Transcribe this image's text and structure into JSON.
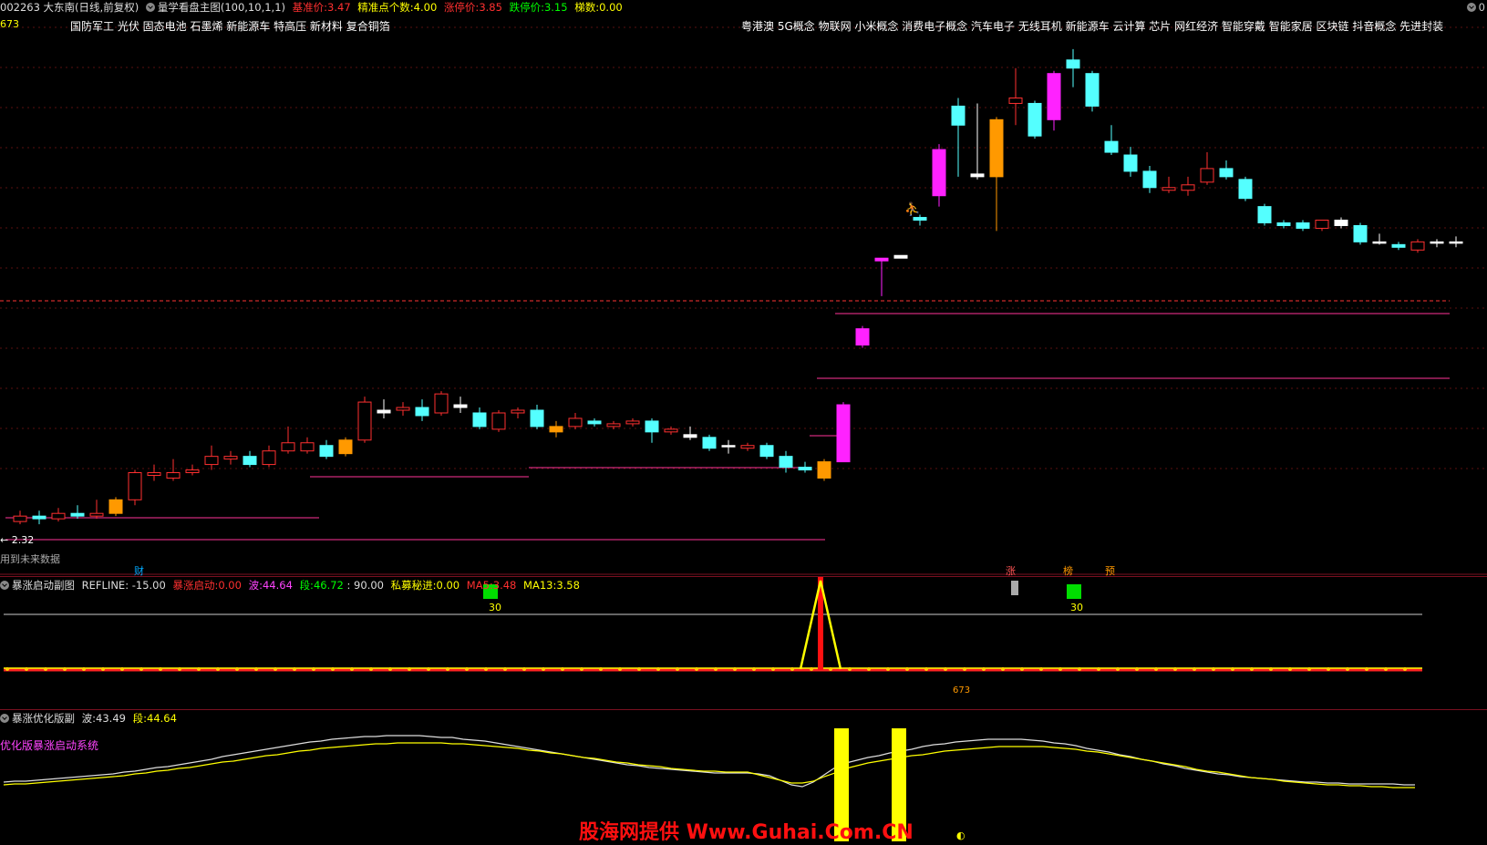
{
  "header": {
    "code_name": "002263 大东南(日线,前复权)",
    "indicator_name": "量学看盘主图(100,10,1,1)",
    "base_price_label": "基准价:",
    "base_price": "3.47",
    "precise_points_label": "精准点个数:",
    "precise_points": "4.00",
    "limit_up_label": "涨停价:",
    "limit_up": "3.85",
    "limit_down_label": "跌停价:",
    "limit_down": "3.15",
    "ladder_label": "梯数:",
    "ladder": "0.00",
    "right_top": "0"
  },
  "left_axis_value": "673",
  "concepts_left": "国防军工 光伏 固态电池 石墨烯 新能源车 特高压 新材料 复合铜箔",
  "concepts_right": "粤港澳 5G概念 物联网 小米概念 消费电子概念 汽车电子 无线耳机 新能源车 云计算 芯片 网红经济 智能穿戴 智能家居 区块链 抖音概念 先进封装",
  "price_low_label": "← 2.32",
  "future_data_label": "用到未来数据",
  "markers": {
    "cai": "财",
    "zhang": "涨",
    "bang": "榜",
    "yu": "预"
  },
  "sub1": {
    "name": "暴涨启动副图",
    "refline": "REFLINE: -15.00",
    "qidong_label": "暴涨启动:",
    "qidong": "0.00",
    "bo_label": "波:",
    "bo": "44.64",
    "duan_label": "段:",
    "duan": "46.72",
    "ninety": ": 90.00",
    "simu_label": "私募秘进:",
    "simu": "0.00",
    "ma5_label": "MA5:",
    "ma5": "3.48",
    "ma13_label": "MA13:",
    "ma13": "3.58",
    "mark30a": "30",
    "mark30b": "30",
    "mark673": "673"
  },
  "sub2": {
    "name": "暴涨优化版副",
    "bo_label": "波:",
    "bo": "43.49",
    "duan_label": "段:",
    "duan": "44.64",
    "system_label": "优化版暴涨启动系统"
  },
  "watermark": "股海网提供 Www.Guhai.Com.CN",
  "colors": {
    "up": "#ff3030",
    "down": "#54ffff",
    "magenta": "#ff22ff",
    "orange": "#ff9900",
    "yellow": "#ffff00",
    "green": "#00dd00",
    "grid": "#5a1010"
  },
  "icons": [
    "indicator-toggle-icon",
    "person-icon",
    "info-circle-icon"
  ],
  "candles": [
    {
      "o": 2.34,
      "c": 2.36,
      "h": 2.38,
      "l": 2.33,
      "t": "u"
    },
    {
      "o": 2.36,
      "c": 2.35,
      "h": 2.38,
      "l": 2.33,
      "t": "d"
    },
    {
      "o": 2.35,
      "c": 2.37,
      "h": 2.39,
      "l": 2.34,
      "t": "u"
    },
    {
      "o": 2.37,
      "c": 2.36,
      "h": 2.4,
      "l": 2.35,
      "t": "d"
    },
    {
      "o": 2.36,
      "c": 2.37,
      "h": 2.42,
      "l": 2.35,
      "t": "u"
    },
    {
      "o": 2.42,
      "c": 2.37,
      "h": 2.43,
      "l": 2.36,
      "t": "o"
    },
    {
      "o": 2.42,
      "c": 2.52,
      "h": 2.53,
      "l": 2.4,
      "t": "u"
    },
    {
      "o": 2.51,
      "c": 2.52,
      "h": 2.55,
      "l": 2.49,
      "t": "u"
    },
    {
      "o": 2.5,
      "c": 2.52,
      "h": 2.57,
      "l": 2.49,
      "t": "u"
    },
    {
      "o": 2.52,
      "c": 2.53,
      "h": 2.55,
      "l": 2.51,
      "t": "u"
    },
    {
      "o": 2.55,
      "c": 2.58,
      "h": 2.62,
      "l": 2.53,
      "t": "u"
    },
    {
      "o": 2.57,
      "c": 2.58,
      "h": 2.6,
      "l": 2.55,
      "t": "u"
    },
    {
      "o": 2.58,
      "c": 2.55,
      "h": 2.6,
      "l": 2.54,
      "t": "d"
    },
    {
      "o": 2.55,
      "c": 2.6,
      "h": 2.62,
      "l": 2.54,
      "t": "u"
    },
    {
      "o": 2.6,
      "c": 2.63,
      "h": 2.69,
      "l": 2.59,
      "t": "u"
    },
    {
      "o": 2.63,
      "c": 2.6,
      "h": 2.65,
      "l": 2.59,
      "t": "u"
    },
    {
      "o": 2.58,
      "c": 2.62,
      "h": 2.64,
      "l": 2.57,
      "t": "d"
    },
    {
      "o": 2.59,
      "c": 2.64,
      "h": 2.65,
      "l": 2.58,
      "t": "o"
    },
    {
      "o": 2.64,
      "c": 2.78,
      "h": 2.8,
      "l": 2.63,
      "t": "u"
    },
    {
      "o": 2.74,
      "c": 2.75,
      "h": 2.79,
      "l": 2.72,
      "t": "w"
    },
    {
      "o": 2.75,
      "c": 2.76,
      "h": 2.78,
      "l": 2.73,
      "t": "u"
    },
    {
      "o": 2.73,
      "c": 2.76,
      "h": 2.79,
      "l": 2.71,
      "t": "d"
    },
    {
      "o": 2.74,
      "c": 2.81,
      "h": 2.82,
      "l": 2.73,
      "t": "u"
    },
    {
      "o": 2.76,
      "c": 2.77,
      "h": 2.8,
      "l": 2.74,
      "t": "w"
    },
    {
      "o": 2.74,
      "c": 2.69,
      "h": 2.76,
      "l": 2.68,
      "t": "d"
    },
    {
      "o": 2.68,
      "c": 2.74,
      "h": 2.75,
      "l": 2.67,
      "t": "u"
    },
    {
      "o": 2.75,
      "c": 2.74,
      "h": 2.76,
      "l": 2.72,
      "t": "u"
    },
    {
      "o": 2.75,
      "c": 2.69,
      "h": 2.77,
      "l": 2.68,
      "t": "d"
    },
    {
      "o": 2.67,
      "c": 2.69,
      "h": 2.71,
      "l": 2.65,
      "t": "o"
    },
    {
      "o": 2.69,
      "c": 2.72,
      "h": 2.74,
      "l": 2.68,
      "t": "u"
    },
    {
      "o": 2.71,
      "c": 2.7,
      "h": 2.72,
      "l": 2.69,
      "t": "d"
    },
    {
      "o": 2.69,
      "c": 2.7,
      "h": 2.71,
      "l": 2.68,
      "t": "u"
    },
    {
      "o": 2.7,
      "c": 2.71,
      "h": 2.72,
      "l": 2.69,
      "t": "u"
    },
    {
      "o": 2.71,
      "c": 2.67,
      "h": 2.72,
      "l": 2.63,
      "t": "d"
    },
    {
      "o": 2.68,
      "c": 2.67,
      "h": 2.69,
      "l": 2.66,
      "t": "u"
    },
    {
      "o": 2.66,
      "c": 2.65,
      "h": 2.69,
      "l": 2.64,
      "t": "w"
    },
    {
      "o": 2.65,
      "c": 2.61,
      "h": 2.66,
      "l": 2.6,
      "t": "d"
    },
    {
      "o": 2.62,
      "c": 2.62,
      "h": 2.64,
      "l": 2.59,
      "t": "w"
    },
    {
      "o": 2.61,
      "c": 2.62,
      "h": 2.63,
      "l": 2.6,
      "t": "u"
    },
    {
      "o": 2.62,
      "c": 2.58,
      "h": 2.63,
      "l": 2.57,
      "t": "d"
    },
    {
      "o": 2.58,
      "c": 2.54,
      "h": 2.6,
      "l": 2.52,
      "t": "d"
    },
    {
      "o": 2.54,
      "c": 2.53,
      "h": 2.56,
      "l": 2.52,
      "t": "d"
    },
    {
      "o": 2.56,
      "c": 2.5,
      "h": 2.57,
      "l": 2.49,
      "t": "o"
    },
    {
      "o": 2.56,
      "c": 2.77,
      "h": 2.78,
      "l": 2.56,
      "t": "m"
    },
    {
      "o": 3.05,
      "c": 2.99,
      "h": 3.06,
      "l": 2.98,
      "t": "m"
    },
    {
      "o": 3.31,
      "c": 3.3,
      "h": 3.31,
      "l": 3.17,
      "t": "m"
    },
    {
      "o": 3.31,
      "c": 3.32,
      "h": 3.32,
      "l": 3.31,
      "t": "w"
    },
    {
      "o": 3.46,
      "c": 3.45,
      "h": 3.47,
      "l": 3.43,
      "t": "d"
    },
    {
      "o": 3.54,
      "c": 3.71,
      "h": 3.73,
      "l": 3.5,
      "t": "m"
    },
    {
      "o": 3.87,
      "c": 3.8,
      "h": 3.9,
      "l": 3.61,
      "t": "d"
    },
    {
      "o": 3.61,
      "c": 3.62,
      "h": 3.88,
      "l": 3.6,
      "t": "w"
    },
    {
      "o": 3.82,
      "c": 3.61,
      "h": 3.83,
      "l": 3.41,
      "t": "o"
    },
    {
      "o": 3.88,
      "c": 3.9,
      "h": 4.01,
      "l": 3.8,
      "t": "u"
    },
    {
      "o": 3.88,
      "c": 3.76,
      "h": 3.89,
      "l": 3.75,
      "t": "d"
    },
    {
      "o": 3.82,
      "c": 3.99,
      "h": 4.0,
      "l": 3.78,
      "t": "m"
    },
    {
      "o": 4.04,
      "c": 4.01,
      "h": 4.08,
      "l": 3.94,
      "t": "d"
    },
    {
      "o": 3.99,
      "c": 3.87,
      "h": 4.0,
      "l": 3.85,
      "t": "d"
    },
    {
      "o": 3.74,
      "c": 3.7,
      "h": 3.8,
      "l": 3.69,
      "t": "d"
    },
    {
      "o": 3.69,
      "c": 3.63,
      "h": 3.72,
      "l": 3.61,
      "t": "d"
    },
    {
      "o": 3.63,
      "c": 3.57,
      "h": 3.65,
      "l": 3.55,
      "t": "d"
    },
    {
      "o": 3.56,
      "c": 3.57,
      "h": 3.61,
      "l": 3.55,
      "t": "u"
    },
    {
      "o": 3.56,
      "c": 3.58,
      "h": 3.61,
      "l": 3.54,
      "t": "u"
    },
    {
      "o": 3.59,
      "c": 3.64,
      "h": 3.7,
      "l": 3.58,
      "t": "u"
    },
    {
      "o": 3.64,
      "c": 3.61,
      "h": 3.67,
      "l": 3.6,
      "t": "d"
    },
    {
      "o": 3.6,
      "c": 3.53,
      "h": 3.61,
      "l": 3.52,
      "t": "d"
    },
    {
      "o": 3.5,
      "c": 3.44,
      "h": 3.51,
      "l": 3.43,
      "t": "d"
    },
    {
      "o": 3.44,
      "c": 3.43,
      "h": 3.45,
      "l": 3.42,
      "t": "d"
    },
    {
      "o": 3.44,
      "c": 3.42,
      "h": 3.45,
      "l": 3.41,
      "t": "d"
    },
    {
      "o": 3.42,
      "c": 3.45,
      "h": 3.45,
      "l": 3.41,
      "t": "u"
    },
    {
      "o": 3.45,
      "c": 3.43,
      "h": 3.46,
      "l": 3.42,
      "t": "w"
    },
    {
      "o": 3.43,
      "c": 3.37,
      "h": 3.44,
      "l": 3.36,
      "t": "d"
    },
    {
      "o": 3.37,
      "c": 3.37,
      "h": 3.4,
      "l": 3.36,
      "t": "w"
    },
    {
      "o": 3.36,
      "c": 3.35,
      "h": 3.37,
      "l": 3.34,
      "t": "d"
    },
    {
      "o": 3.34,
      "c": 3.37,
      "h": 3.38,
      "l": 3.33,
      "t": "u"
    },
    {
      "o": 3.37,
      "c": 3.37,
      "h": 3.38,
      "l": 3.35,
      "t": "w"
    },
    {
      "o": 3.37,
      "c": 3.37,
      "h": 3.39,
      "l": 3.35,
      "t": "w"
    }
  ]
}
